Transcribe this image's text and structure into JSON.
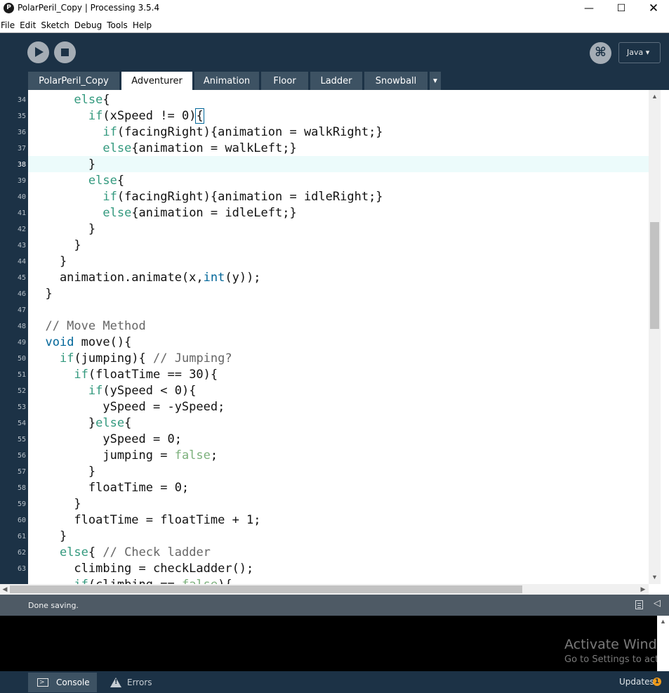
{
  "window": {
    "app_icon": "processing-logo-icon",
    "title": "PolarPeril_Copy | Processing 3.5.4",
    "minimize": "—",
    "maximize": "☐",
    "close": "✕"
  },
  "menu": [
    "File",
    "Edit",
    "Sketch",
    "Debug",
    "Tools",
    "Help"
  ],
  "toolbar": {
    "run_icon": "play-icon",
    "stop_icon": "stop-icon",
    "mode_icon": "debug-butterfly-icon",
    "mode_glyph": "⌘",
    "language": "Java ▾"
  },
  "tabs": [
    "PolarPeril_Copy",
    "Adventurer",
    "Animation",
    "Floor",
    "Ladder",
    "Snowball"
  ],
  "active_tab": "Adventurer",
  "tab_more": "▼",
  "editor": {
    "current_line": 38,
    "lines": [
      {
        "n": "34",
        "tokens": [
          {
            "t": "      ",
            "c": ""
          },
          {
            "t": "else",
            "c": "kw"
          },
          {
            "t": "{",
            "c": ""
          }
        ]
      },
      {
        "n": "35",
        "tokens": [
          {
            "t": "        ",
            "c": ""
          },
          {
            "t": "if",
            "c": "kw"
          },
          {
            "t": "(xSpeed != 0)",
            "c": ""
          },
          {
            "t": "{",
            "c": "hl"
          }
        ]
      },
      {
        "n": "36",
        "tokens": [
          {
            "t": "          ",
            "c": ""
          },
          {
            "t": "if",
            "c": "kw"
          },
          {
            "t": "(facingRight){animation = walkRight;}",
            "c": ""
          }
        ]
      },
      {
        "n": "37",
        "tokens": [
          {
            "t": "          ",
            "c": ""
          },
          {
            "t": "else",
            "c": "kw"
          },
          {
            "t": "{animation = walkLeft;}",
            "c": ""
          }
        ]
      },
      {
        "n": "38",
        "tokens": [
          {
            "t": "        }",
            "c": ""
          }
        ]
      },
      {
        "n": "39",
        "tokens": [
          {
            "t": "        ",
            "c": ""
          },
          {
            "t": "else",
            "c": "kw"
          },
          {
            "t": "{",
            "c": ""
          }
        ]
      },
      {
        "n": "40",
        "tokens": [
          {
            "t": "          ",
            "c": ""
          },
          {
            "t": "if",
            "c": "kw"
          },
          {
            "t": "(facingRight){animation = idleRight;}",
            "c": ""
          }
        ]
      },
      {
        "n": "41",
        "tokens": [
          {
            "t": "          ",
            "c": ""
          },
          {
            "t": "else",
            "c": "kw"
          },
          {
            "t": "{animation = idleLeft;}",
            "c": ""
          }
        ]
      },
      {
        "n": "42",
        "tokens": [
          {
            "t": "        }",
            "c": ""
          }
        ]
      },
      {
        "n": "43",
        "tokens": [
          {
            "t": "      }",
            "c": ""
          }
        ]
      },
      {
        "n": "44",
        "tokens": [
          {
            "t": "    }",
            "c": ""
          }
        ]
      },
      {
        "n": "45",
        "tokens": [
          {
            "t": "    animation.animate(x,",
            "c": ""
          },
          {
            "t": "int",
            "c": "ty"
          },
          {
            "t": "(y));",
            "c": ""
          }
        ]
      },
      {
        "n": "46",
        "tokens": [
          {
            "t": "  }",
            "c": ""
          }
        ]
      },
      {
        "n": "47",
        "tokens": [
          {
            "t": "",
            "c": ""
          }
        ]
      },
      {
        "n": "48",
        "tokens": [
          {
            "t": "  // Move Method",
            "c": "cm"
          }
        ]
      },
      {
        "n": "49",
        "tokens": [
          {
            "t": "  ",
            "c": ""
          },
          {
            "t": "void",
            "c": "ty"
          },
          {
            "t": " move(){",
            "c": ""
          }
        ]
      },
      {
        "n": "50",
        "tokens": [
          {
            "t": "    ",
            "c": ""
          },
          {
            "t": "if",
            "c": "kw"
          },
          {
            "t": "(jumping){ ",
            "c": ""
          },
          {
            "t": "// Jumping?",
            "c": "cm"
          }
        ]
      },
      {
        "n": "51",
        "tokens": [
          {
            "t": "      ",
            "c": ""
          },
          {
            "t": "if",
            "c": "kw"
          },
          {
            "t": "(floatTime == 30){",
            "c": ""
          }
        ]
      },
      {
        "n": "52",
        "tokens": [
          {
            "t": "        ",
            "c": ""
          },
          {
            "t": "if",
            "c": "kw"
          },
          {
            "t": "(ySpeed < 0){",
            "c": ""
          }
        ]
      },
      {
        "n": "53",
        "tokens": [
          {
            "t": "          ySpeed = -ySpeed;",
            "c": ""
          }
        ]
      },
      {
        "n": "54",
        "tokens": [
          {
            "t": "        }",
            "c": ""
          },
          {
            "t": "else",
            "c": "kw"
          },
          {
            "t": "{",
            "c": ""
          }
        ]
      },
      {
        "n": "55",
        "tokens": [
          {
            "t": "          ySpeed = 0;",
            "c": ""
          }
        ]
      },
      {
        "n": "56",
        "tokens": [
          {
            "t": "          jumping = ",
            "c": ""
          },
          {
            "t": "false",
            "c": "lit"
          },
          {
            "t": ";",
            "c": ""
          }
        ]
      },
      {
        "n": "57",
        "tokens": [
          {
            "t": "        }",
            "c": ""
          }
        ]
      },
      {
        "n": "58",
        "tokens": [
          {
            "t": "        floatTime = 0;",
            "c": ""
          }
        ]
      },
      {
        "n": "59",
        "tokens": [
          {
            "t": "      }",
            "c": ""
          }
        ]
      },
      {
        "n": "60",
        "tokens": [
          {
            "t": "      floatTime = floatTime + 1;",
            "c": ""
          }
        ]
      },
      {
        "n": "61",
        "tokens": [
          {
            "t": "    }",
            "c": ""
          }
        ]
      },
      {
        "n": "62",
        "tokens": [
          {
            "t": "    ",
            "c": ""
          },
          {
            "t": "else",
            "c": "kw"
          },
          {
            "t": "{ ",
            "c": ""
          },
          {
            "t": "// Check ladder",
            "c": "cm"
          }
        ]
      },
      {
        "n": "63",
        "tokens": [
          {
            "t": "      climbing = checkLadder();",
            "c": ""
          }
        ]
      },
      {
        "n": "",
        "tokens": [
          {
            "t": "      ",
            "c": ""
          },
          {
            "t": "if",
            "c": "kw"
          },
          {
            "t": "(climbing == ",
            "c": ""
          },
          {
            "t": "false",
            "c": "lit"
          },
          {
            "t": "){",
            "c": ""
          }
        ]
      }
    ]
  },
  "scroll": {
    "up_arrow": "▲",
    "down_arrow": "▼",
    "left_arrow": "◀",
    "right_arrow": "▶"
  },
  "status": {
    "message": "Done saving.",
    "copy_icon": "copy-icon",
    "collapse_glyph": "◁"
  },
  "console": {
    "watermark_title": "Activate Windows",
    "watermark_sub": "Go to Settings to activate Windows."
  },
  "footer": {
    "console_label": "Console",
    "errors_label": "Errors",
    "updates_label": "Updates",
    "updates_count": "1"
  },
  "colors": {
    "chrome": "#1c3246",
    "tab_inactive": "#3d5263",
    "keyword": "#33997e",
    "type": "#006699",
    "literal": "#7bb07b",
    "comment": "#666666",
    "current_line": "#ecfbfb"
  }
}
